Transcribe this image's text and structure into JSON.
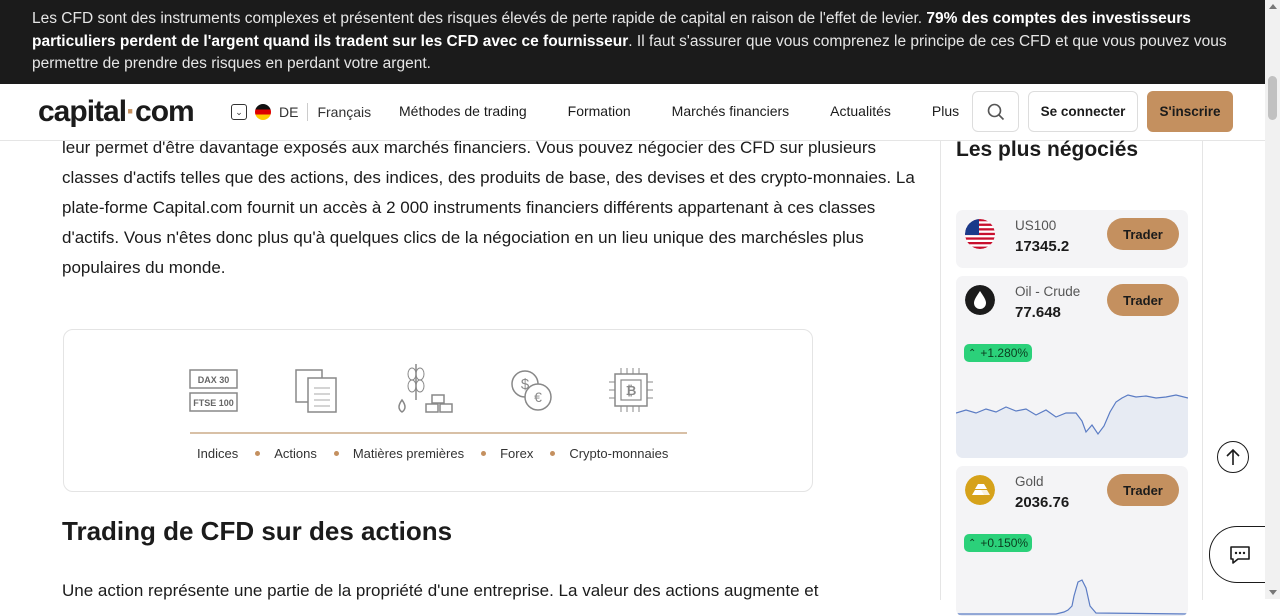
{
  "risk_warning": {
    "part1": "Les CFD sont des instruments complexes et présentent des risques élevés de perte rapide de capital en raison de l'effet de levier. ",
    "bold": "79% des comptes des investisseurs particuliers perdent de l'argent quand ils tradent sur les CFD avec ce fournisseur",
    "part2": ". Il faut s'assurer que vous comprenez le principe de ces CFD et que vous pouvez vous permettre de prendre des risques en perdant votre argent."
  },
  "header": {
    "logo_main": "capital",
    "logo_dot": "·",
    "logo_tld": "com",
    "country": "DE",
    "language": "Français",
    "nav": [
      "Méthodes de trading",
      "Formation",
      "Marchés financiers",
      "Actualités",
      "Plus"
    ],
    "login_label": "Se connecter",
    "signup_label": "S'inscrire"
  },
  "article": {
    "paragraph": "leur permet d'être davantage exposés aux marchés financiers. Vous pouvez négocier des CFD sur plusieurs classes d'actifs telles que des actions, des indices, des produits de base, des devises et des crypto-monnaies. La plate-forme Capital.com fournit un accès à 2 000 instruments financiers différents appartenant à ces classes d'actifs. Vous n'êtes donc plus qu'à quelques clics de la négociation en un lieu unique des marchésles plus populaires du monde.",
    "icon_dax": "DAX 30",
    "icon_ftse": "FTSE 100",
    "asset_classes": [
      "Indices",
      "Actions",
      "Matières premières",
      "Forex",
      "Crypto-monnaies"
    ],
    "heading": "Trading de CFD sur des actions",
    "paragraph2": "Une action représente une partie de la propriété d'une entreprise. La valeur des actions augmente et"
  },
  "sidebar": {
    "title": "Les plus négociés",
    "trade_label": "Trader",
    "instruments": [
      {
        "name": "US100",
        "price": "17345.2",
        "icon": "us-flag-icon"
      },
      {
        "name": "Oil - Crude",
        "price": "77.648",
        "change": "+1.280%",
        "icon": "oil-drop-icon",
        "color": "#2bd17a"
      },
      {
        "name": "Gold",
        "price": "2036.76",
        "change": "+0.150%",
        "icon": "gold-bars-icon",
        "color": "#2bd17a"
      }
    ]
  },
  "colors": {
    "brand": "#c4905f",
    "positive": "#2bd17a",
    "banner": "#1b1b1b"
  }
}
